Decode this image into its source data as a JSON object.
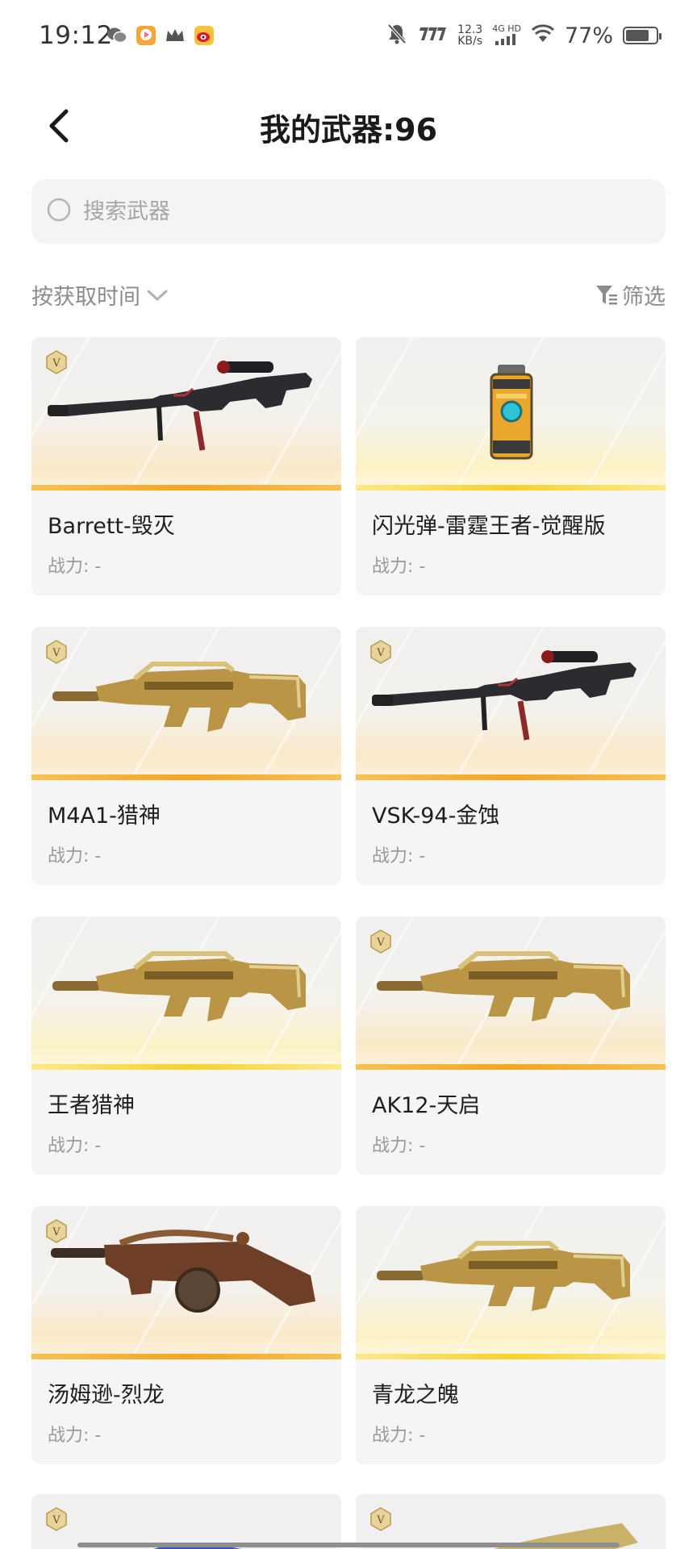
{
  "status_bar": {
    "time": "19:12",
    "speed_value": "12.3",
    "speed_unit": "KB/s",
    "network": "4G HD",
    "battery_pct": "77%",
    "battery_level": 0.77
  },
  "header": {
    "title": "我的武器:96"
  },
  "search": {
    "placeholder": "搜索武器"
  },
  "toolbar": {
    "sort_label": "按获取时间",
    "filter_label": "筛选"
  },
  "weapons": [
    {
      "name": "Barrett-毁灭",
      "power": "战力: -",
      "badge": true,
      "style": "orange",
      "icon": "sniper-rifle-icon"
    },
    {
      "name": "闪光弹-雷霆王者-觉醒版",
      "power": "战力: -",
      "badge": false,
      "style": "gold",
      "icon": "flash-grenade-icon"
    },
    {
      "name": "M4A1-猎神",
      "power": "战力: -",
      "badge": true,
      "style": "orange",
      "icon": "assault-rifle-icon"
    },
    {
      "name": "VSK-94-金蚀",
      "power": "战力: -",
      "badge": true,
      "style": "orange",
      "icon": "sniper-rifle-icon"
    },
    {
      "name": "王者猎神",
      "power": "战力: -",
      "badge": false,
      "style": "gold",
      "icon": "assault-rifle-icon"
    },
    {
      "name": "AK12-天启",
      "power": "战力: -",
      "badge": true,
      "style": "orange",
      "icon": "assault-rifle-icon"
    },
    {
      "name": "汤姆逊-烈龙",
      "power": "战力: -",
      "badge": true,
      "style": "orange",
      "icon": "submachine-gun-icon"
    },
    {
      "name": "青龙之魄",
      "power": "战力: -",
      "badge": false,
      "style": "gold",
      "icon": "assault-rifle-icon"
    }
  ]
}
